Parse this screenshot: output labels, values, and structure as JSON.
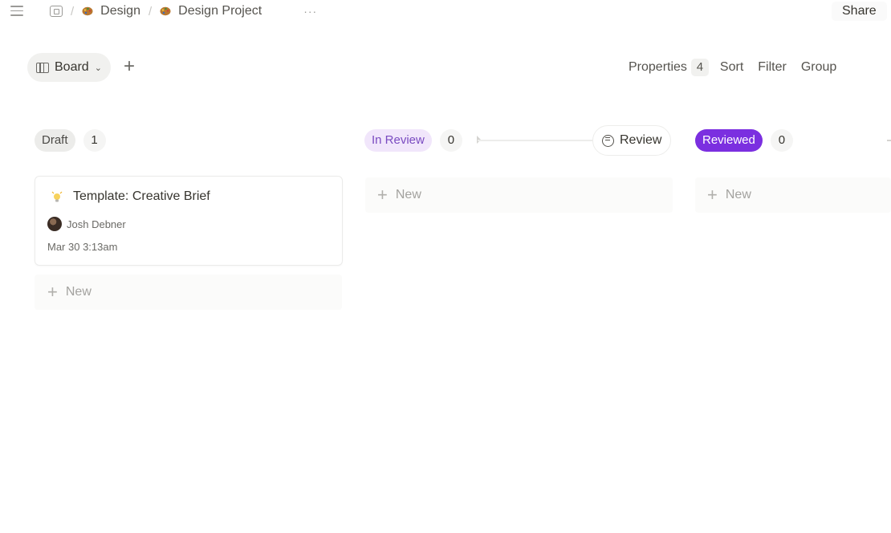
{
  "breadcrumb": {
    "items": [
      "Design",
      "Design Project"
    ],
    "separator": "/",
    "more": "···"
  },
  "header": {
    "share_label": "Share"
  },
  "toolbar": {
    "view_label": "Board",
    "view_chevron": "⌄",
    "add_view": "+",
    "properties_label": "Properties",
    "properties_count": "4",
    "sort_label": "Sort",
    "filter_label": "Filter",
    "group_label": "Group"
  },
  "columns": [
    {
      "label": "Draft",
      "count": "1",
      "new_label": "New"
    },
    {
      "label": "In Review",
      "count": "0",
      "new_label": "New"
    },
    {
      "label": "Reviewed",
      "count": "0",
      "new_label": "New"
    }
  ],
  "review_action": {
    "label": "Review"
  },
  "cards": [
    {
      "title": "Template: Creative Brief",
      "person": "Josh Debner",
      "date": "Mar 30 3:13am"
    }
  ],
  "colors": {
    "accent_purple": "#7b2fe0",
    "in_review_bg": "#f1e6fb",
    "in_review_text": "#7a4bc1",
    "draft_bg": "#ececea"
  },
  "icons": {
    "menu": "hamburger-icon",
    "home": "page-icon",
    "crumb": "palette-icon",
    "view": "board-icon",
    "review": "chat-bubble-icon",
    "card": "lightbulb-icon",
    "avatar": "avatar"
  }
}
